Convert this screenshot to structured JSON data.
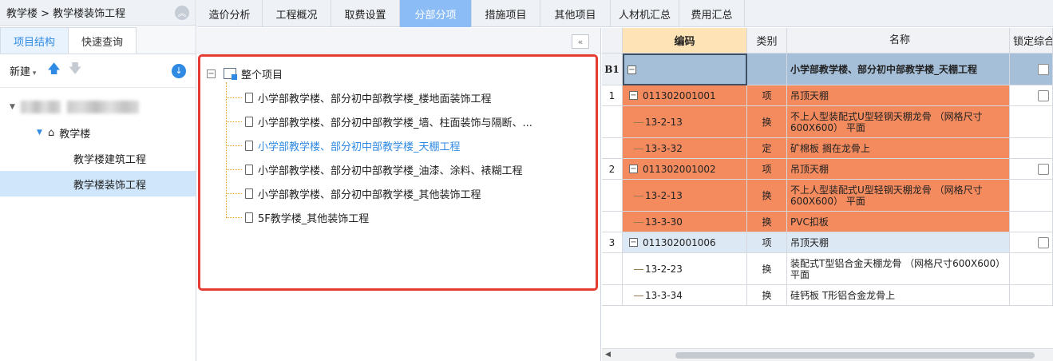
{
  "left": {
    "breadcrumb": "教学楼 > 教学楼装饰工程",
    "tabs": [
      "项目结构",
      "快速查询"
    ],
    "new_label": "新建",
    "tree": {
      "building": "教学楼",
      "children": [
        "教学楼建筑工程",
        "教学楼装饰工程"
      ]
    }
  },
  "tabs": [
    "造价分析",
    "工程概况",
    "取费设置",
    "分部分项",
    "措施项目",
    "其他项目",
    "人材机汇总",
    "费用汇总"
  ],
  "active_tab": "分部分项",
  "middle": {
    "root": "整个项目",
    "items": [
      "小学部教学楼、部分初中部教学楼_楼地面装饰工程",
      "小学部教学楼、部分初中部教学楼_墙、柱面装饰与隔断、...",
      "小学部教学楼、部分初中部教学楼_天棚工程",
      "小学部教学楼、部分初中部教学楼_油漆、涂料、裱糊工程",
      "小学部教学楼、部分初中部教学楼_其他装饰工程",
      "5F教学楼_其他装饰工程"
    ]
  },
  "grid": {
    "headers": [
      "编码",
      "类别",
      "名称",
      "锁定综合"
    ],
    "rows": [
      {
        "no": "B1",
        "code": "",
        "type": "",
        "name": "小学部教学楼、部分初中部教学楼_天棚工程",
        "style": "b1"
      },
      {
        "no": "1",
        "code": "011302001001",
        "type": "项",
        "name": "吊顶天棚",
        "style": "or",
        "checkbox": true
      },
      {
        "no": "",
        "code": "13-2-13",
        "type": "换",
        "name": "不上人型装配式U型轻钢天棚龙骨 （网格尺寸600X600） 平面",
        "style": "or"
      },
      {
        "no": "",
        "code": "13-3-32",
        "type": "定",
        "name": "矿棉板 搁在龙骨上",
        "style": "or"
      },
      {
        "no": "2",
        "code": "011302001002",
        "type": "项",
        "name": "吊顶天棚",
        "style": "or",
        "checkbox": true
      },
      {
        "no": "",
        "code": "13-2-13",
        "type": "换",
        "name": "不上人型装配式U型轻钢天棚龙骨 （网格尺寸600X600） 平面",
        "style": "or"
      },
      {
        "no": "",
        "code": "13-3-30",
        "type": "换",
        "name": "PVC扣板",
        "style": "or"
      },
      {
        "no": "3",
        "code": "011302001006",
        "type": "项",
        "name": "吊顶天棚",
        "style": "lb",
        "checkbox": true
      },
      {
        "no": "",
        "code": "13-2-23",
        "type": "换",
        "name": "装配式T型铝合金天棚龙骨 （网格尺寸600X600） 平面",
        "style": "wh"
      },
      {
        "no": "",
        "code": "13-3-34",
        "type": "换",
        "name": "硅钙板 T形铝合金龙骨上",
        "style": "wh"
      }
    ]
  },
  "colors": {
    "accent": "#2f8ae3",
    "active_tab": "#8bbcf5",
    "row_orange": "#f48b5f",
    "highlight_red": "#e43b32"
  }
}
